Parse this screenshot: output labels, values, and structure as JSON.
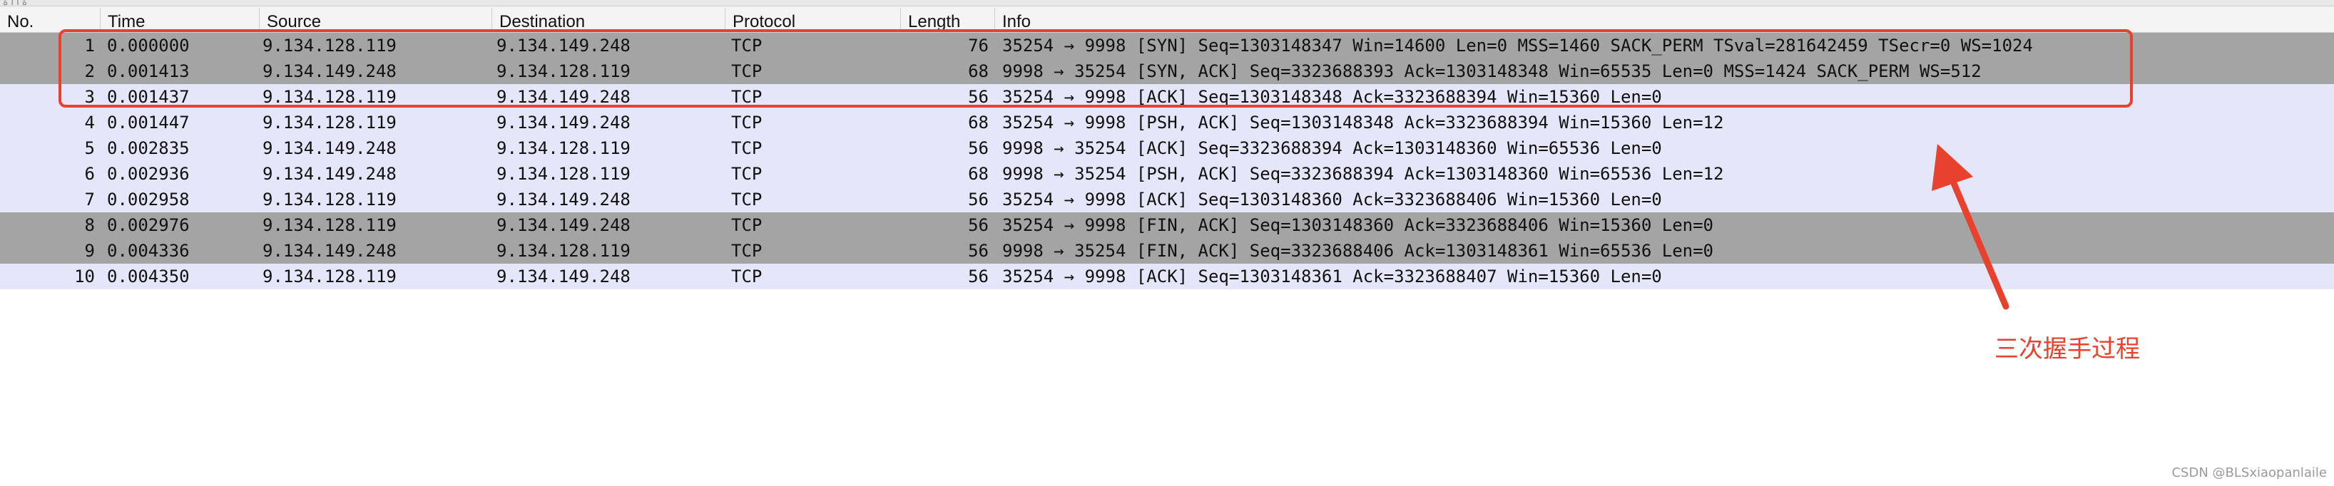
{
  "top_fragment": "ة ا ا ة",
  "columns": {
    "no": "No.",
    "time": "Time",
    "source": "Source",
    "destination": "Destination",
    "protocol": "Protocol",
    "length": "Length",
    "info": "Info"
  },
  "packets": [
    {
      "no": "1",
      "time": "0.000000",
      "source": "9.134.128.119",
      "destination": "9.134.149.248",
      "protocol": "TCP",
      "length": "76",
      "info": "35254 → 9998 [SYN] Seq=1303148347 Win=14600 Len=0 MSS=1460 SACK_PERM TSval=281642459 TSecr=0 WS=1024",
      "style": "gray"
    },
    {
      "no": "2",
      "time": "0.001413",
      "source": "9.134.149.248",
      "destination": "9.134.128.119",
      "protocol": "TCP",
      "length": "68",
      "info": "9998 → 35254 [SYN, ACK] Seq=3323688393 Ack=1303148348 Win=65535 Len=0 MSS=1424 SACK_PERM WS=512",
      "style": "gray"
    },
    {
      "no": "3",
      "time": "0.001437",
      "source": "9.134.128.119",
      "destination": "9.134.149.248",
      "protocol": "TCP",
      "length": "56",
      "info": "35254 → 9998 [ACK] Seq=1303148348 Ack=3323688394 Win=15360 Len=0",
      "style": "lav"
    },
    {
      "no": "4",
      "time": "0.001447",
      "source": "9.134.128.119",
      "destination": "9.134.149.248",
      "protocol": "TCP",
      "length": "68",
      "info": "35254 → 9998 [PSH, ACK] Seq=1303148348 Ack=3323688394 Win=15360 Len=12",
      "style": "lav"
    },
    {
      "no": "5",
      "time": "0.002835",
      "source": "9.134.149.248",
      "destination": "9.134.128.119",
      "protocol": "TCP",
      "length": "56",
      "info": "9998 → 35254 [ACK] Seq=3323688394 Ack=1303148360 Win=65536 Len=0",
      "style": "lav"
    },
    {
      "no": "6",
      "time": "0.002936",
      "source": "9.134.149.248",
      "destination": "9.134.128.119",
      "protocol": "TCP",
      "length": "68",
      "info": "9998 → 35254 [PSH, ACK] Seq=3323688394 Ack=1303148360 Win=65536 Len=12",
      "style": "lav"
    },
    {
      "no": "7",
      "time": "0.002958",
      "source": "9.134.128.119",
      "destination": "9.134.149.248",
      "protocol": "TCP",
      "length": "56",
      "info": "35254 → 9998 [ACK] Seq=1303148360 Ack=3323688406 Win=15360 Len=0",
      "style": "lav"
    },
    {
      "no": "8",
      "time": "0.002976",
      "source": "9.134.128.119",
      "destination": "9.134.149.248",
      "protocol": "TCP",
      "length": "56",
      "info": "35254 → 9998 [FIN, ACK] Seq=1303148360 Ack=3323688406 Win=15360 Len=0",
      "style": "gray"
    },
    {
      "no": "9",
      "time": "0.004336",
      "source": "9.134.149.248",
      "destination": "9.134.128.119",
      "protocol": "TCP",
      "length": "56",
      "info": "9998 → 35254 [FIN, ACK] Seq=3323688406 Ack=1303148361 Win=65536 Len=0",
      "style": "gray"
    },
    {
      "no": "10",
      "time": "0.004350",
      "source": "9.134.128.119",
      "destination": "9.134.149.248",
      "protocol": "TCP",
      "length": "56",
      "info": "35254 → 9998 [ACK] Seq=1303148361 Ack=3323688407 Win=15360 Len=0",
      "style": "lav"
    }
  ],
  "annotation": {
    "label": "三次握手过程",
    "color": "#e8412d"
  },
  "watermark": "CSDN @BLSxiaopanlaile",
  "colors": {
    "row_gray": "#a4a4a4",
    "row_lavender": "#e6e6fb",
    "accent_red": "#e8412d"
  }
}
